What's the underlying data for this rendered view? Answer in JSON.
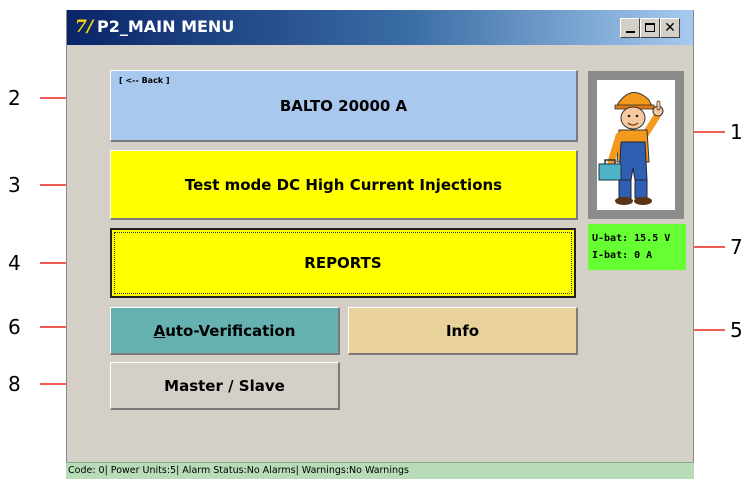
{
  "window": {
    "title": "P2_MAIN MENU",
    "app_icon_glyph": "7/",
    "controls": [
      "minimize",
      "maximize",
      "close"
    ],
    "close_glyph": "✕"
  },
  "main": {
    "back_label": "[ <-- Back ]",
    "device_name": "BALTO 20000 A",
    "test_mode_label": "Test mode DC High Current Injections",
    "reports_label": "REPORTS",
    "auto_verification_label": "Auto-Verification",
    "auto_verification_underline_char": "A",
    "auto_verification_rest": "uto-Verification",
    "info_label": "Info",
    "master_slave_label": "Master / Slave"
  },
  "battery": {
    "u_bat": "U-bat: 15.5 V",
    "i_bat": "I-bat: 0 A"
  },
  "status_bar": {
    "text": "Code: 0| Power Units:5| Alarm Status:No Alarms| Warnings:No Warnings"
  },
  "callouts": {
    "c1": "1",
    "c2": "2",
    "c3": "3",
    "c4": "4",
    "c5": "5",
    "c6": "6",
    "c7": "7",
    "c8": "8"
  },
  "colors": {
    "device_button": "#a8c8ee",
    "yellow_buttons": "#ffff00",
    "auto_verification": "#66b2b2",
    "info": "#e8d19a",
    "battery_panel": "#66ff33",
    "status_bar": "#b8dcb8",
    "arrow": "#e8281e"
  },
  "icons": {
    "avatar": "worker-with-toolbox-icon"
  }
}
